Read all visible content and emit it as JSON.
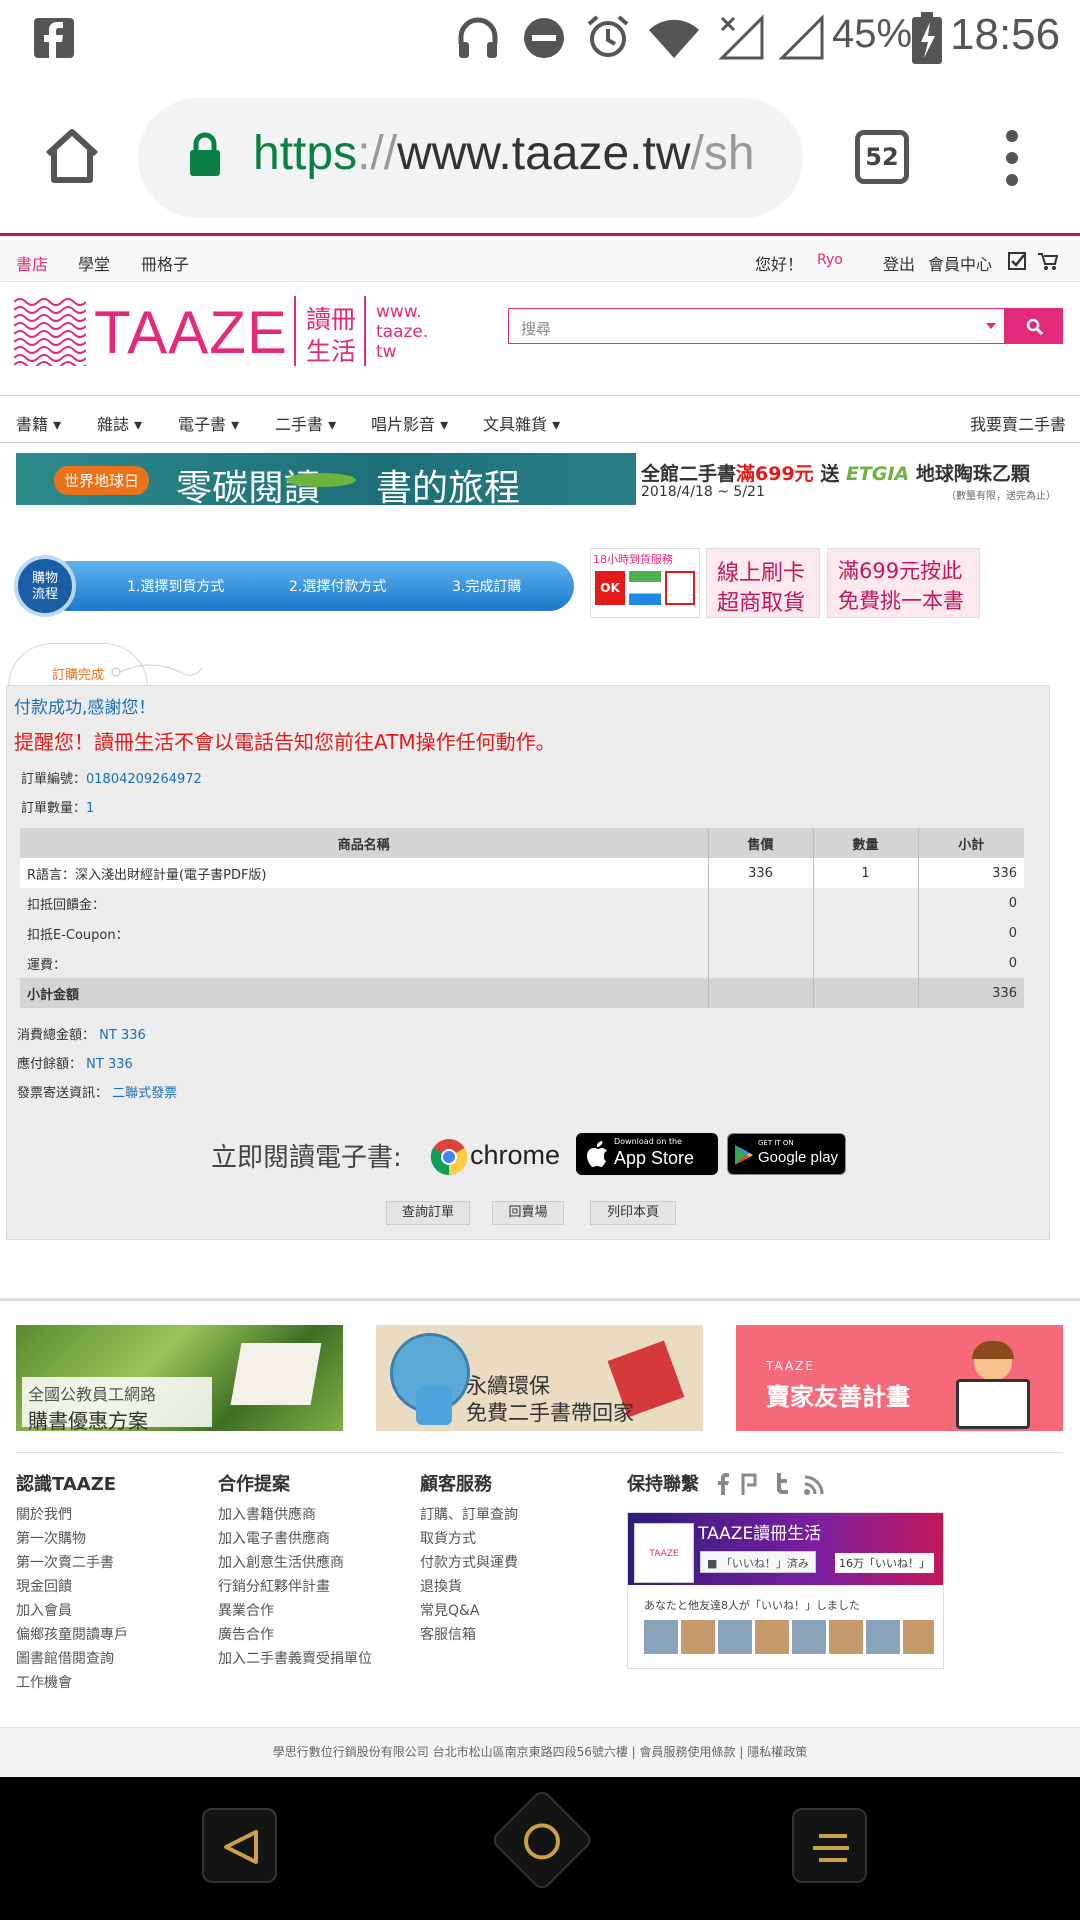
{
  "status_bar": {
    "battery": "45%",
    "time": "18:56"
  },
  "browser": {
    "url_scheme": "https",
    "url_sep": "://",
    "url_rest": "www.taaze.tw",
    "url_tail": "/sh",
    "tab_count": "52"
  },
  "site_top": {
    "links": [
      "書店",
      "學堂",
      "冊格子"
    ],
    "greeting": "您好！",
    "user": "Ryo",
    "logout": "登出",
    "member_center": "會員中心"
  },
  "logo": {
    "brand": "TAAZE",
    "cn_1": "讀冊",
    "cn_2": "生活",
    "web_1": "www.",
    "web_2": "taaze.",
    "web_3": "tw"
  },
  "search": {
    "placeholder": "搜尋"
  },
  "nav": {
    "items": [
      "書籍",
      "雜誌",
      "電子書",
      "二手書",
      "唱片影音",
      "文具雜貨"
    ],
    "sell": "我要賣二手書"
  },
  "banner": {
    "tag": "世界地球日",
    "headline_1": "零碳閱讀",
    "headline_2": "書的旅程",
    "promo_a": "全館二手書",
    "promo_b": "滿699元",
    "promo_c": "送",
    "promo_brand": "ETGIA",
    "promo_gift": "地球陶珠乙顆",
    "date": "2018/4/18 ~ 5/21",
    "note": "（數量有限，送完為止）"
  },
  "steps": {
    "label_1": "購物",
    "label_2": "流程",
    "step1": "1.選擇到貨方式",
    "step2": "2.選擇付款方式",
    "step3": "3.完成訂購"
  },
  "promos": {
    "delivery_title": "18小時到貨服務",
    "card_1": "線上刷卡",
    "card_2": "超商取貨",
    "gift_1": "滿699元按此",
    "gift_2": "免費挑一本書"
  },
  "order": {
    "tab": "訂購完成",
    "success": "付款成功,感謝您！",
    "warning": "提醒您！讀冊生活不會以電話告知您前往ATM操作任何動作。",
    "order_no_label": "訂單編號：",
    "order_no": "01804209264972",
    "qty_label": "訂單數量：",
    "qty": "1",
    "columns": [
      "商品名稱",
      "售價",
      "數量",
      "小計"
    ],
    "rows": [
      {
        "name": "R語言：深入淺出財經計量(電子書PDF版)",
        "price": "336",
        "qty": "1",
        "subtotal": "336"
      },
      {
        "name": "扣抵回饋金：",
        "price": "",
        "qty": "",
        "subtotal": "0"
      },
      {
        "name": "扣抵E-Coupon：",
        "price": "",
        "qty": "",
        "subtotal": "0"
      },
      {
        "name": "運費：",
        "price": "",
        "qty": "",
        "subtotal": "0"
      },
      {
        "name": "小計金額",
        "price": "",
        "qty": "",
        "subtotal": "336"
      }
    ],
    "total_label": "消費總金額：",
    "total": "NT 336",
    "due_label": "應付餘額：",
    "due": "NT 336",
    "invoice_label": "發票寄送資訊：",
    "invoice": "二聯式發票",
    "read_now": "立即閱讀電子書:",
    "chrome": "chrome",
    "appstore_small": "Download on the",
    "appstore": "App Store",
    "gplay_small": "GET IT ON",
    "gplay": "Google play",
    "btn_query": "查詢訂單",
    "btn_back": "回賣場",
    "btn_print": "列印本頁"
  },
  "ads": {
    "ad1_line1": "全國公教員工網路",
    "ad1_line2": "購書優惠方案",
    "ad2_line1": "永續環保",
    "ad2_line2": "免費二手書帶回家",
    "ad3_brand": "TAAZE",
    "ad3_text": "賣家友善計畫"
  },
  "footer": {
    "col1": {
      "title": "認識TAAZE",
      "items": [
        "關於我們",
        "第一次購物",
        "第一次賣二手書",
        "現金回饋",
        "加入會員",
        "偏鄉孩童閱讀專戶",
        "圖書館借閱查詢",
        "工作機會"
      ]
    },
    "col2": {
      "title": "合作提案",
      "items": [
        "加入書籍供應商",
        "加入電子書供應商",
        "加入創意生活供應商",
        "行銷分紅夥伴計畫",
        "異業合作",
        "廣告合作",
        "加入二手書義賣受捐單位"
      ]
    },
    "col3": {
      "title": "顧客服務",
      "items": [
        "訂購、訂單查詢",
        "取貨方式",
        "付款方式與運費",
        "退換貨",
        "常見Q&A",
        "客服信箱"
      ]
    },
    "col4": {
      "title": "保持聯繫"
    },
    "fb_page": "TAAZE讀冊生活",
    "fb_like": "「いいね！」済み",
    "fb_count": "16万「いいね！」",
    "fb_friends": "あなたと他友達8人が「いいね！」しました",
    "copyright": "學思行數位行銷股份有限公司 台北市松山區南京東路四段56號六樓 | 會員服務使用條款 | 隱私權政策"
  },
  "colors": {
    "brand": "#e2297a",
    "link": "#1a6fb5",
    "warning": "#e41b1b"
  }
}
